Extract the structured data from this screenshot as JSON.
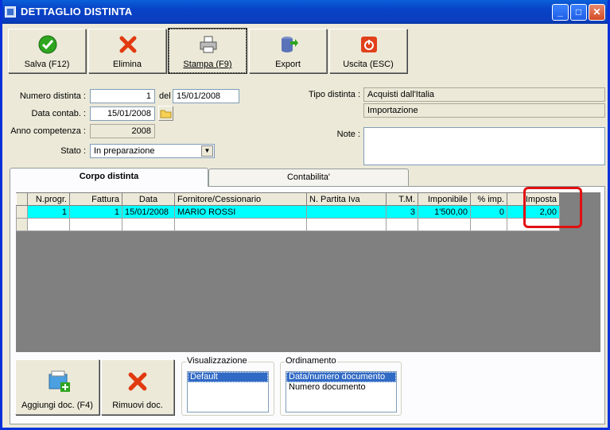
{
  "window": {
    "title": "DETTAGLIO DISTINTA",
    "min": "_",
    "max": "□",
    "close": "✕"
  },
  "toolbar": {
    "save": "Salva (F12)",
    "delete": "Elimina",
    "print": "Stampa (F9)",
    "export": "Export",
    "exit": "Uscita (ESC)"
  },
  "form": {
    "numero_label": "Numero distinta :",
    "numero_value": "1",
    "del_label": "del",
    "del_value": "15/01/2008",
    "data_label": "Data contab. :",
    "data_value": "15/01/2008",
    "anno_label": "Anno competenza :",
    "anno_value": "2008",
    "stato_label": "Stato :",
    "stato_value": "In preparazione",
    "tipo_label": "Tipo distinta :",
    "tipo_value1": "Acquisti dall'Italia",
    "tipo_value2": "Importazione",
    "note_label": "Note :",
    "note_value": ""
  },
  "tabs": [
    "Corpo distinta",
    "Contabilita'"
  ],
  "grid": {
    "columns": [
      "N.progr.",
      "Fattura",
      "Data",
      "Fornitore/Cessionario",
      "N. Partita Iva",
      "T.M.",
      "Imponibile",
      "% imp.",
      "Imposta"
    ],
    "rows": [
      [
        "1",
        "1",
        "15/01/2008",
        "MARIO ROSSI",
        "",
        "3",
        "1'500,00",
        "0",
        "2,00"
      ]
    ]
  },
  "bottom": {
    "add": "Aggiungi doc. (F4)",
    "remove": "Rimuovi doc.",
    "vis_label": "Visualizzazione",
    "vis_items": [
      "Default"
    ],
    "ord_label": "Ordinamento",
    "ord_items": [
      "Data/numero documento",
      "Numero documento"
    ]
  }
}
